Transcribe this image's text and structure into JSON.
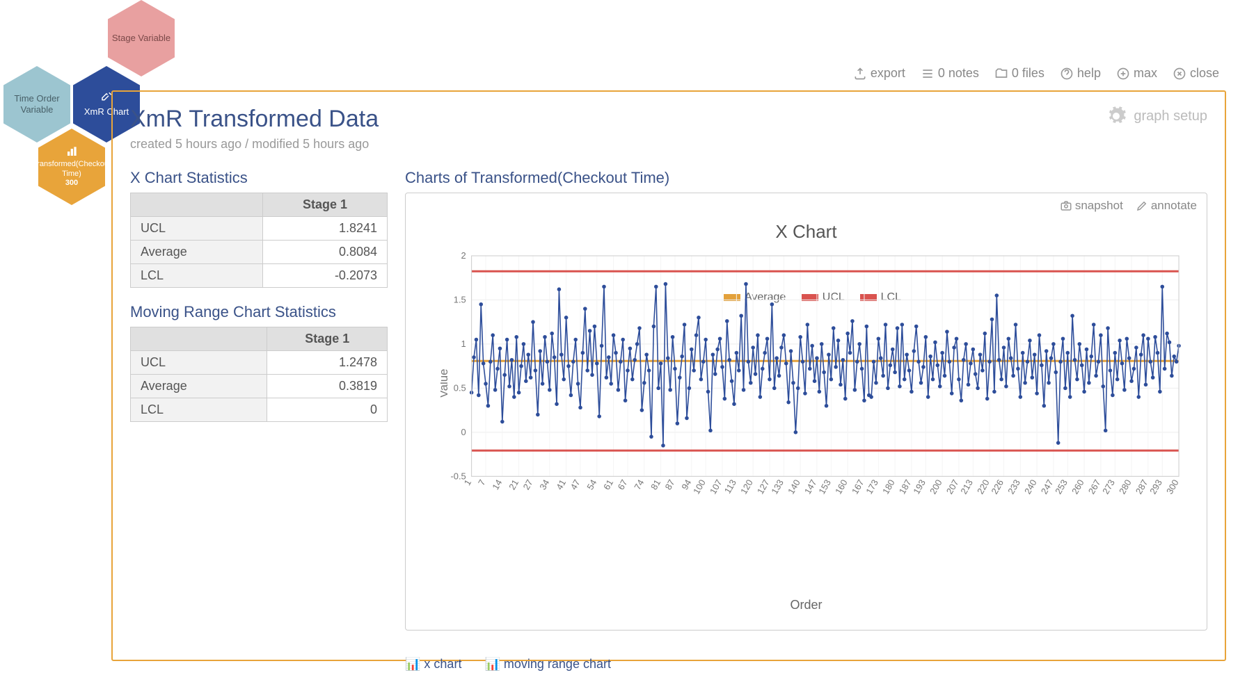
{
  "hex": {
    "stage": "Stage Variable",
    "time": "Time Order Variable",
    "xmr": "XmR Chart",
    "trans": "Transformed(Checkout Time)",
    "n": "300"
  },
  "toolbar": {
    "export": "export",
    "notes": "0 notes",
    "files": "0 files",
    "help": "help",
    "max": "max",
    "close": "close"
  },
  "page": {
    "title": "XmR Transformed Data",
    "meta": "created 5 hours ago / modified 5 hours ago",
    "gear": "graph setup"
  },
  "xstats": {
    "title": "X Chart Statistics",
    "stage": "Stage 1",
    "rows": [
      [
        "UCL",
        "1.8241"
      ],
      [
        "Average",
        "0.8084"
      ],
      [
        "LCL",
        "-0.2073"
      ]
    ]
  },
  "mrstats": {
    "title": "Moving Range Chart Statistics",
    "stage": "Stage 1",
    "rows": [
      [
        "UCL",
        "1.2478"
      ],
      [
        "Average",
        "0.3819"
      ],
      [
        "LCL",
        "0"
      ]
    ]
  },
  "chart": {
    "supertitle": "Charts of Transformed(Checkout Time)",
    "title": "X Chart",
    "ylabel": "Value",
    "xlabel": "Order",
    "snapshot": "snapshot",
    "annotate": "annotate",
    "legend": [
      "Average",
      "UCL",
      "LCL"
    ],
    "tabs": [
      "x chart",
      "moving range chart"
    ]
  },
  "chart_data": {
    "type": "line",
    "title": "X Chart",
    "xlabel": "Order",
    "ylabel": "Value",
    "ylim": [
      -0.5,
      2
    ],
    "xlim": [
      1,
      300
    ],
    "xticks": [
      1,
      7,
      14,
      21,
      27,
      34,
      41,
      47,
      54,
      61,
      67,
      74,
      81,
      87,
      94,
      100,
      107,
      113,
      120,
      127,
      133,
      140,
      147,
      153,
      160,
      167,
      173,
      180,
      187,
      193,
      200,
      207,
      213,
      220,
      226,
      233,
      240,
      247,
      253,
      260,
      267,
      273,
      280,
      287,
      293,
      300
    ],
    "yticks": [
      -0.5,
      0,
      0.5,
      1,
      1.5,
      2
    ],
    "reference_lines": {
      "Average": 0.8084,
      "UCL": 1.8241,
      "LCL": -0.2073
    },
    "series": [
      {
        "name": "Transformed(Checkout Time)",
        "x_start": 1,
        "x_step": 1,
        "n": 300,
        "values": [
          0.45,
          0.85,
          1.05,
          0.42,
          1.45,
          0.78,
          0.55,
          0.3,
          0.8,
          1.1,
          0.48,
          0.72,
          0.95,
          0.12,
          0.65,
          1.05,
          0.52,
          0.82,
          0.4,
          1.08,
          0.45,
          0.75,
          1.0,
          0.58,
          0.88,
          0.62,
          1.25,
          0.7,
          0.2,
          0.92,
          0.55,
          1.08,
          0.8,
          0.48,
          1.12,
          0.85,
          0.32,
          1.62,
          0.88,
          0.6,
          1.3,
          0.75,
          0.42,
          0.8,
          1.05,
          0.55,
          0.28,
          0.9,
          1.4,
          0.7,
          1.15,
          0.65,
          1.2,
          0.78,
          0.18,
          0.98,
          1.65,
          0.62,
          0.85,
          0.55,
          1.1,
          0.9,
          0.48,
          0.8,
          1.05,
          0.36,
          0.7,
          0.95,
          0.6,
          0.82,
          1.0,
          1.18,
          0.25,
          0.56,
          0.88,
          0.7,
          -0.05,
          1.2,
          1.65,
          0.5,
          0.78,
          -0.15,
          1.68,
          0.84,
          0.48,
          1.08,
          0.72,
          0.1,
          0.62,
          0.86,
          1.22,
          0.16,
          0.5,
          0.94,
          0.7,
          1.1,
          1.3,
          0.6,
          0.8,
          1.05,
          0.46,
          0.02,
          0.88,
          0.66,
          0.94,
          1.06,
          0.74,
          0.38,
          1.26,
          0.82,
          0.58,
          0.32,
          0.9,
          0.7,
          1.32,
          0.48,
          1.68,
          0.8,
          0.56,
          0.96,
          0.66,
          1.1,
          0.4,
          0.72,
          0.9,
          1.06,
          0.6,
          1.45,
          0.5,
          0.84,
          0.64,
          0.96,
          1.1,
          0.78,
          0.34,
          0.92,
          0.56,
          0.0,
          0.5,
          1.08,
          0.8,
          0.44,
          1.22,
          0.72,
          0.98,
          0.58,
          0.84,
          0.46,
          1.0,
          0.68,
          0.3,
          0.88,
          0.6,
          1.18,
          0.74,
          1.04,
          0.54,
          0.82,
          0.38,
          1.12,
          0.9,
          1.26,
          0.48,
          0.8,
          1.0,
          0.72,
          0.36,
          1.2,
          0.42,
          0.4,
          0.8,
          0.56,
          1.06,
          0.84,
          0.64,
          1.22,
          0.5,
          0.76,
          0.94,
          0.68,
          1.18,
          0.52,
          1.22,
          0.6,
          0.88,
          0.7,
          0.46,
          0.92,
          1.2,
          0.8,
          0.56,
          0.74,
          1.08,
          0.4,
          0.86,
          0.6,
          1.02,
          0.76,
          0.52,
          0.9,
          0.64,
          1.14,
          0.8,
          0.44,
          0.96,
          1.06,
          0.6,
          0.36,
          0.82,
          1.0,
          0.54,
          0.78,
          0.94,
          0.66,
          0.5,
          0.88,
          0.7,
          1.12,
          0.38,
          0.8,
          1.28,
          0.46,
          1.55,
          0.82,
          0.6,
          0.96,
          0.52,
          1.06,
          0.84,
          0.64,
          1.22,
          0.72,
          0.4,
          0.9,
          0.56,
          0.8,
          1.04,
          0.62,
          0.88,
          0.44,
          1.1,
          0.76,
          0.3,
          0.92,
          0.56,
          0.84,
          1.0,
          0.68,
          -0.12,
          0.8,
          1.06,
          0.5,
          0.9,
          0.4,
          1.32,
          0.82,
          0.6,
          1.0,
          0.76,
          0.46,
          0.94,
          0.56,
          0.86,
          1.22,
          0.64,
          0.8,
          1.1,
          0.52,
          0.02,
          1.18,
          0.7,
          0.42,
          0.9,
          0.6,
          1.04,
          0.78,
          0.48,
          1.06,
          0.84,
          0.58,
          0.72,
          0.96,
          0.4,
          0.88,
          1.1,
          0.54,
          1.06,
          0.8,
          0.62,
          1.08,
          0.9,
          0.46,
          1.65,
          0.72,
          1.12,
          1.02,
          0.64,
          0.86,
          0.8,
          0.98
        ]
      }
    ]
  }
}
